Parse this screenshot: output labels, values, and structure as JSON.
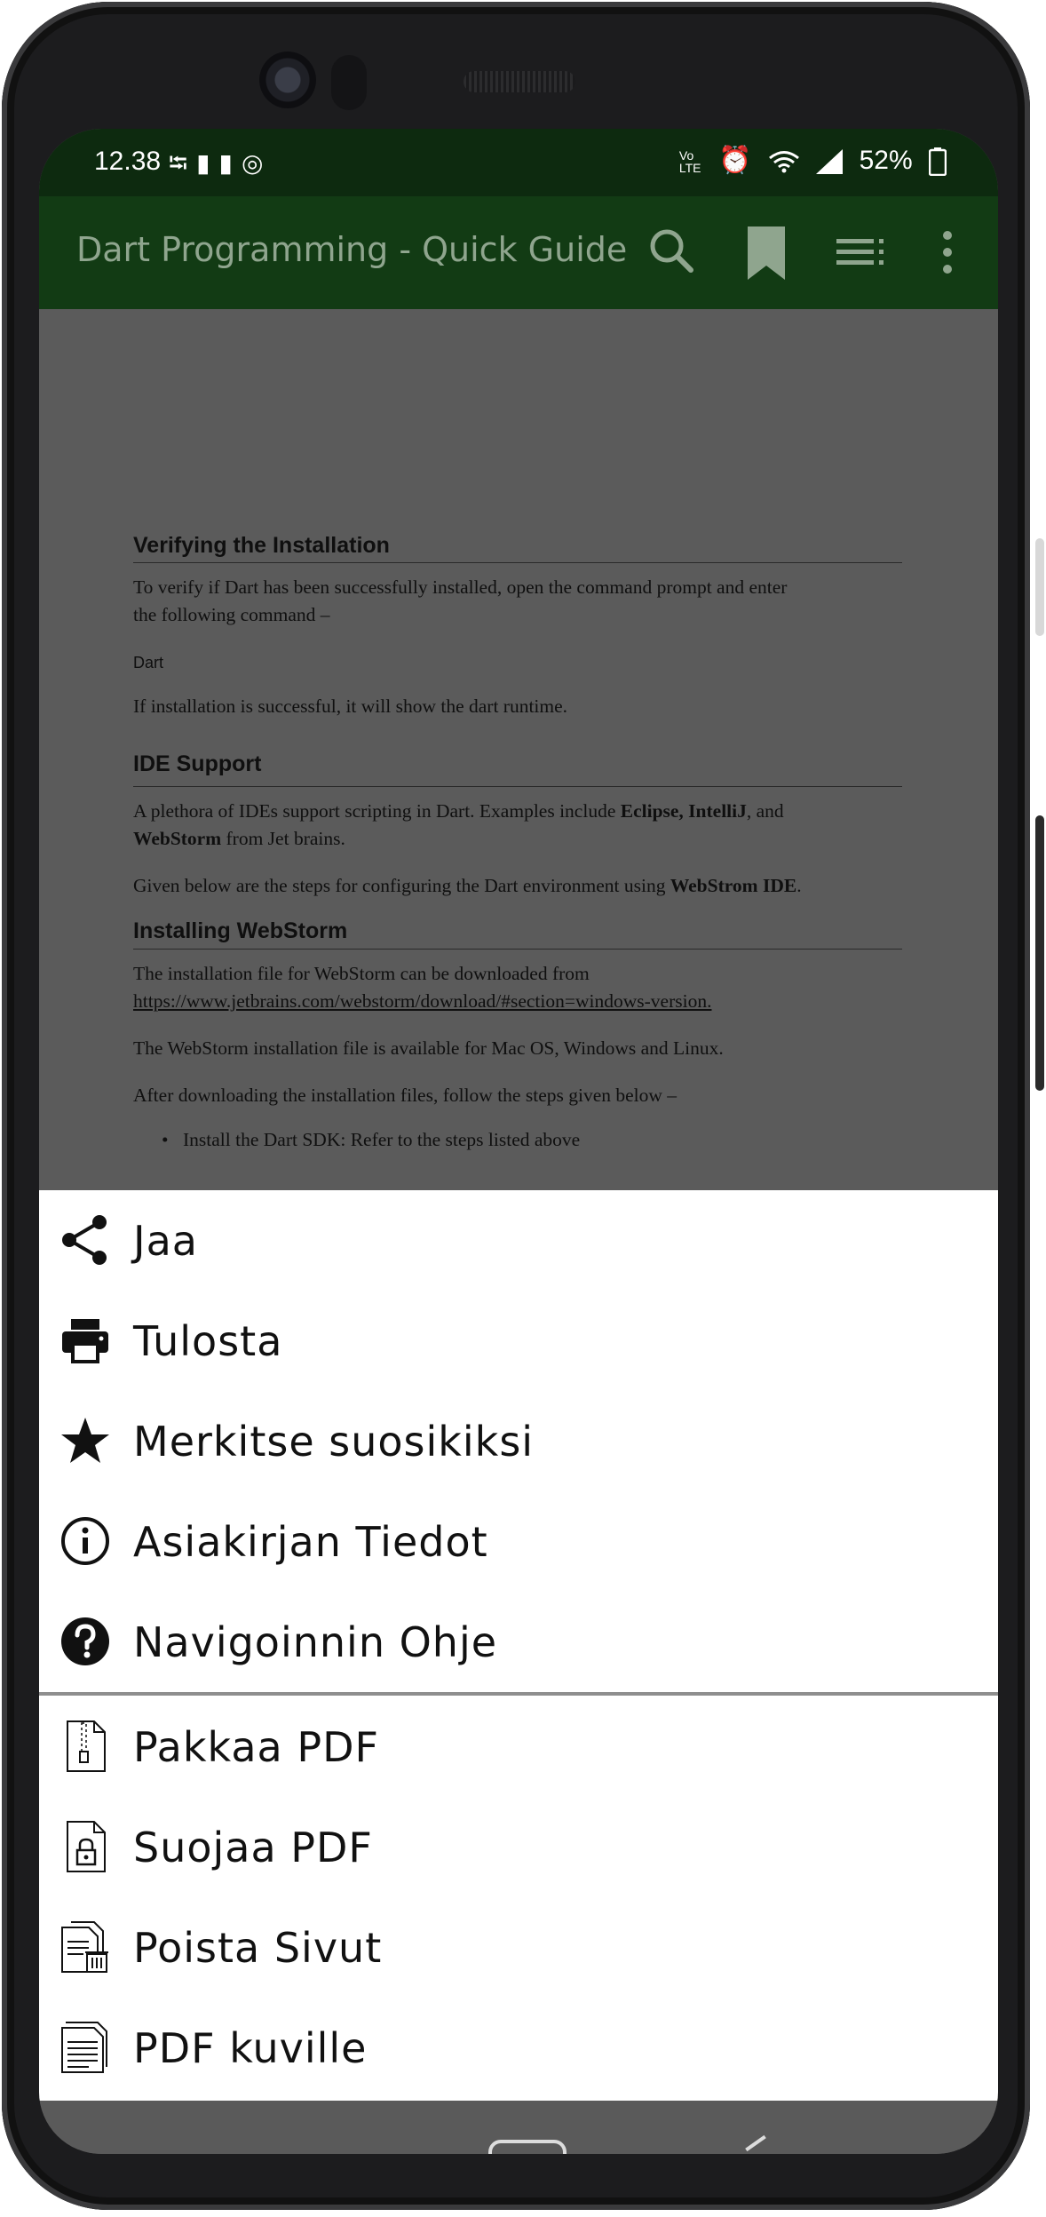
{
  "status_bar": {
    "time": "12.38",
    "left_icons": [
      "usb-icon",
      "battery-saver-icon",
      "battery-plus-icon",
      "app-icon"
    ],
    "network_label": "Vo LTE",
    "battery_percent": "52%"
  },
  "app_bar": {
    "title": "Dart Programming - Quick Guide",
    "icons": [
      "search-icon",
      "bookmark-icon",
      "list-icon",
      "more-icon"
    ]
  },
  "document": {
    "section1_title": "Verifying the Installation",
    "section1_p1_line1": "To verify if Dart has been successfully installed, open the command prompt and enter",
    "section1_p1_line2": "the following command –",
    "section1_code": "Dart",
    "section1_p2": "If installation is successful, it will show the dart runtime.",
    "section2_title": "IDE Support",
    "section2_p1_a": "A plethora of IDEs support scripting in Dart. Examples include ",
    "section2_p1_bold1": "Eclipse, IntelliJ",
    "section2_p1_b": ", and",
    "section2_p1_bold2": "WebStorm",
    "section2_p1_c": " from Jet brains.",
    "section2_p2_a": "Given below are the steps for configuring the Dart environment using ",
    "section2_p2_bold": "WebStrom IDE",
    "section2_p2_b": ".",
    "section3_title": "Installing WebStorm",
    "section3_p1_line1": "The installation file for WebStorm can be downloaded from",
    "section3_p1_link": "https://www.jetbrains.com/webstorm/download/#section=windows-version.",
    "section3_p2": "The WebStorm installation file is available for Mac OS, Windows and Linux.",
    "section3_p3": "After downloading the installation files, follow the steps given below –",
    "section3_li1": "Install the Dart SDK: Refer to the steps listed above"
  },
  "menu": {
    "items": [
      {
        "label": "Jaa",
        "icon": "share-icon"
      },
      {
        "label": "Tulosta",
        "icon": "print-icon"
      },
      {
        "label": "Merkitse suosikiksi",
        "icon": "star-icon"
      },
      {
        "label": "Asiakirjan Tiedot",
        "icon": "info-icon"
      },
      {
        "label": "Navigoinnin Ohje",
        "icon": "help-icon"
      }
    ],
    "tools": [
      {
        "label": "Pakkaa PDF",
        "icon": "zip-file-icon"
      },
      {
        "label": "Suojaa PDF",
        "icon": "lock-file-icon"
      },
      {
        "label": "Poista Sivut",
        "icon": "delete-pages-icon"
      },
      {
        "label": "PDF kuville",
        "icon": "pdf-to-image-icon"
      }
    ]
  }
}
